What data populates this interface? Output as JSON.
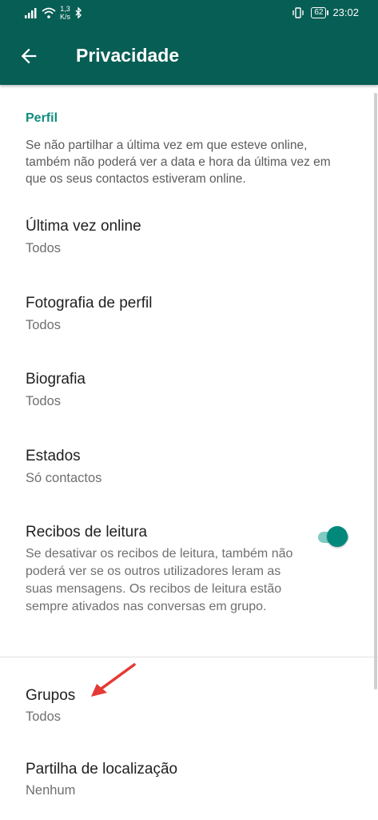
{
  "status_bar": {
    "speed_value": "1,3",
    "speed_unit": "K/s",
    "battery": "62",
    "time": "23:02"
  },
  "app_bar": {
    "title": "Privacidade",
    "back_icon": "arrow-back-icon"
  },
  "profile_section": {
    "header": "Perfil",
    "description": "Se não partilhar a última vez em que esteve online, também não poderá ver a data e hora da última vez em que os seus contactos estiveram online."
  },
  "settings": [
    {
      "title": "Última vez online",
      "value": "Todos"
    },
    {
      "title": "Fotografia de perfil",
      "value": "Todos"
    },
    {
      "title": "Biografia",
      "value": "Todos"
    },
    {
      "title": "Estados",
      "value": "Só contactos"
    }
  ],
  "read_receipts": {
    "title": "Recibos de leitura",
    "description": "Se desativar os recibos de leitura, também não poderá ver se os outros utilizadores leram as suas mensagens. Os recibos de leitura estão sempre ativados nas conversas em grupo.",
    "enabled": true
  },
  "groups": {
    "title": "Grupos",
    "value": "Todos"
  },
  "location": {
    "title": "Partilha de localização",
    "value": "Nenhum"
  },
  "colors": {
    "primary_dark": "#075e54",
    "accent": "#128c7e",
    "toggle_on": "#00897b",
    "annotation_arrow": "#e53935"
  }
}
